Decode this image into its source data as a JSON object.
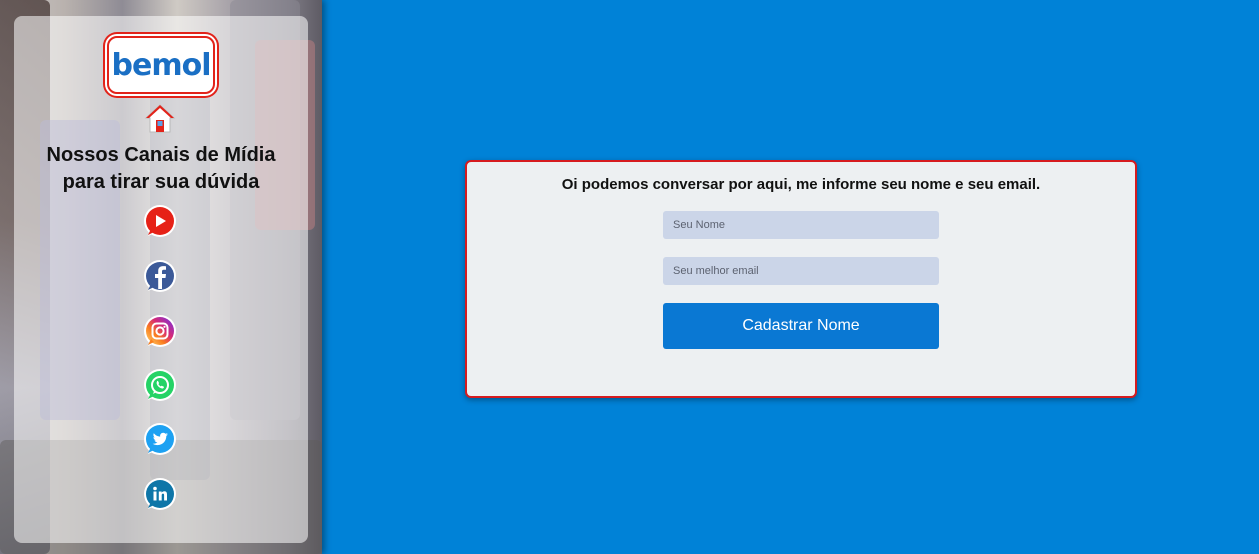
{
  "sidebar": {
    "logo_text": "bemol",
    "title_line1": "Nossos Canais de Mídia",
    "title_line2": "para tirar sua dúvida",
    "social": [
      {
        "name": "youtube-icon",
        "color": "#e62117"
      },
      {
        "name": "facebook-icon",
        "color": "#3b5998"
      },
      {
        "name": "instagram-icon",
        "color": "#c13584"
      },
      {
        "name": "whatsapp-icon",
        "color": "#25d366"
      },
      {
        "name": "twitter-icon",
        "color": "#1da1f2"
      },
      {
        "name": "linkedin-icon",
        "color": "#0e76a8"
      }
    ]
  },
  "form": {
    "heading": "Oi podemos conversar por aqui, me informe seu nome e seu email.",
    "name_placeholder": "Seu Nome",
    "name_value": "",
    "email_placeholder": "Seu melhor email",
    "email_value": "",
    "submit_label": "Cadastrar Nome"
  },
  "colors": {
    "background": "#0082d7",
    "accent_red": "#d61b1f",
    "button": "#0a78d3",
    "input": "#cbd5e8"
  }
}
